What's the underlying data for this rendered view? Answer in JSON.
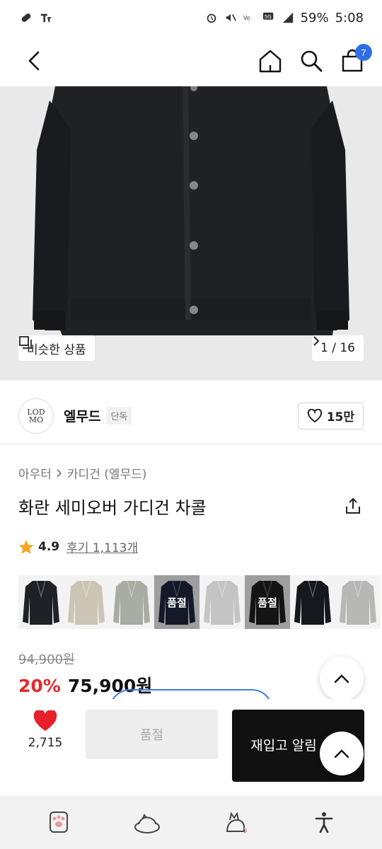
{
  "status_bar": {
    "battery_percent": "59%",
    "time": "5:08",
    "network": "5G"
  },
  "header": {
    "cart_count": "7",
    "icons": [
      "back-arrow-icon",
      "home-icon",
      "search-icon",
      "shopping-bag-icon"
    ]
  },
  "hero": {
    "similar_label": "비슷한 상품",
    "page_indicator": "1 / 16"
  },
  "brand": {
    "logo_text_top": "LOD",
    "logo_text_bottom": "MO",
    "name": "엘무드",
    "tag": "단독",
    "likes": "15만"
  },
  "product": {
    "category": "아우터",
    "subcategory": "카디건 (엘무드)",
    "title": "화란 세미오버 가디건 차콜",
    "rating": "4.9",
    "reviews": "후기 1,113개"
  },
  "variants": [
    {
      "color": "#1f2126",
      "sold_out": false
    },
    {
      "color": "#cbc5b5",
      "sold_out": false
    },
    {
      "color": "#a9aca3",
      "sold_out": false
    },
    {
      "color": "#1e2740",
      "sold_out": true,
      "label": "품절"
    },
    {
      "color": "#c4c4c4",
      "sold_out": false
    },
    {
      "color": "#202020",
      "sold_out": true,
      "label": "품절"
    },
    {
      "color": "#15181c",
      "sold_out": false
    },
    {
      "color": "#b7b7b5",
      "sold_out": false
    }
  ],
  "price": {
    "original": "94,900원",
    "discount": "20%",
    "sale": "75,900원"
  },
  "action_bar": {
    "wish_count": "2,715",
    "soldout_label": "품절",
    "restock_label": "재입고 알림 신청"
  },
  "colors": {
    "accent_blue": "#2f6ee8",
    "discount_red": "#e4282b",
    "heart_red": "#e8202a",
    "star_gold": "#f5a623"
  }
}
